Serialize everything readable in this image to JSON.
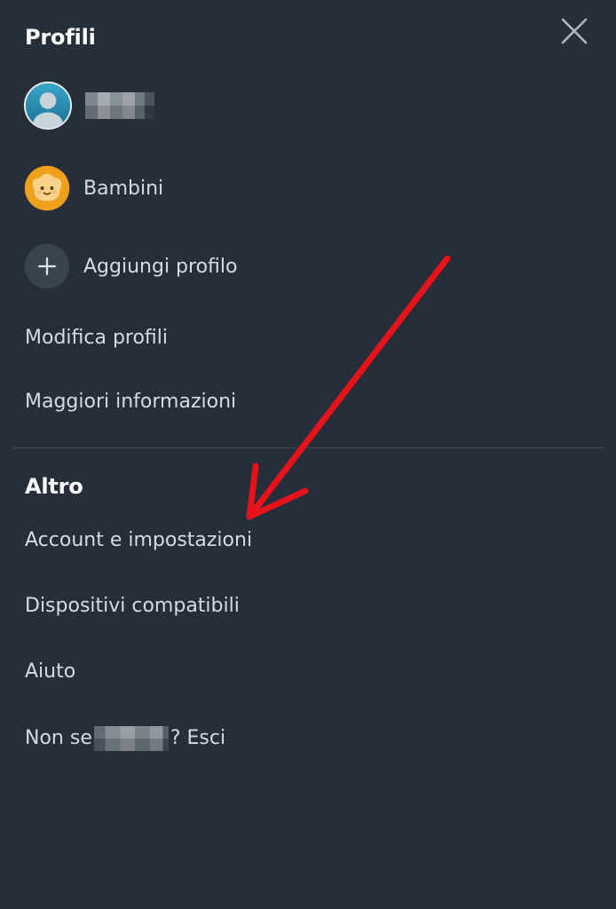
{
  "profiles": {
    "title": "Profili",
    "items": [
      {
        "label": "",
        "icon": "user-avatar-icon"
      },
      {
        "label": "Bambini",
        "icon": "kids-avatar-icon"
      },
      {
        "label": "Aggiungi profilo",
        "icon": "plus-icon"
      }
    ],
    "edit_label": "Modifica profili",
    "more_info_label": "Maggiori informazioni"
  },
  "altro": {
    "title": "Altro",
    "items": [
      {
        "label": "Account e impostazioni"
      },
      {
        "label": "Dispositivi compatibili"
      },
      {
        "label": "Aiuto"
      }
    ],
    "signout_prefix": "Non se",
    "signout_suffix": "? Esci"
  },
  "colors": {
    "background": "#252e39",
    "text": "#d6dbe1",
    "heading": "#ffffff",
    "annotation_arrow": "#e8131a",
    "kids_avatar": "#f0a11c",
    "add_button_bg": "#3a4450"
  },
  "close_icon": "close-icon"
}
